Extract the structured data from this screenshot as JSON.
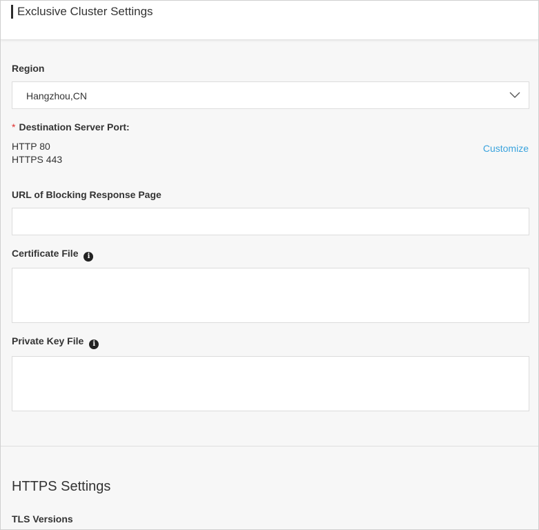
{
  "header": {
    "title": "Exclusive Cluster Settings"
  },
  "region": {
    "label": "Region",
    "selected": "Hangzhou,CN",
    "chevron_icon": "chevron-down-icon"
  },
  "destination_port": {
    "required_mark": "*",
    "label": "Destination Server Port:",
    "ports": [
      "HTTP 80",
      "HTTPS 443"
    ],
    "customize_label": "Customize"
  },
  "blocking_page": {
    "label": "URL of Blocking Response Page",
    "value": ""
  },
  "certificate": {
    "label": "Certificate File",
    "info_icon": "info-icon",
    "value": ""
  },
  "private_key": {
    "label": "Private Key File",
    "info_icon": "info-icon",
    "value": ""
  },
  "https_settings": {
    "title": "HTTPS Settings",
    "tls_label": "TLS Versions"
  },
  "colors": {
    "link": "#3aa3dd",
    "required": "#e0302f",
    "border": "#dcdcdc",
    "background": "#f7f7f7"
  }
}
